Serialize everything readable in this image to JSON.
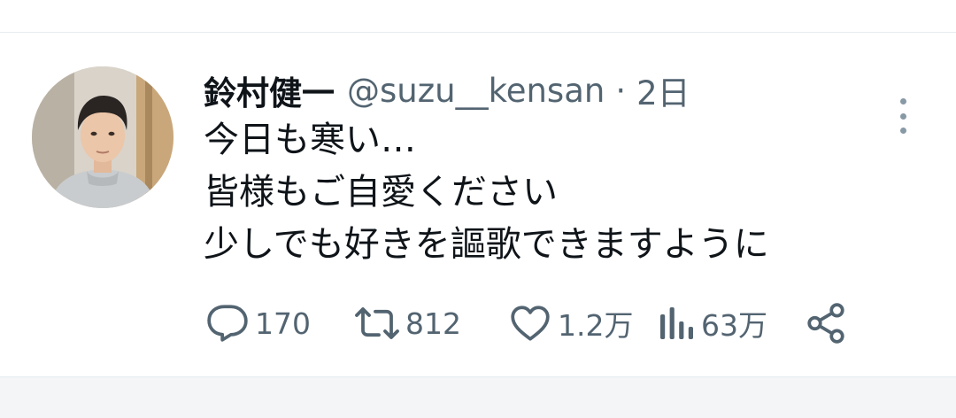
{
  "tweet": {
    "display_name": "鈴村健一",
    "handle": "@suzu__kensan",
    "separator": "·",
    "time": "2日",
    "lines": [
      "今日も寒い…",
      "皆様もご自愛ください",
      "少しでも好きを謳歌できますように"
    ],
    "stats": {
      "replies": "170",
      "retweets": "812",
      "likes": "1.2万",
      "views": "63万"
    }
  },
  "icons": {
    "reply": "reply-icon",
    "retweet": "retweet-icon",
    "like": "heart-icon",
    "views": "views-icon",
    "share": "share-icon",
    "more": "more-icon"
  },
  "colors": {
    "text": "#0f1419",
    "secondary": "#536471",
    "divider": "#e6ecf0"
  }
}
